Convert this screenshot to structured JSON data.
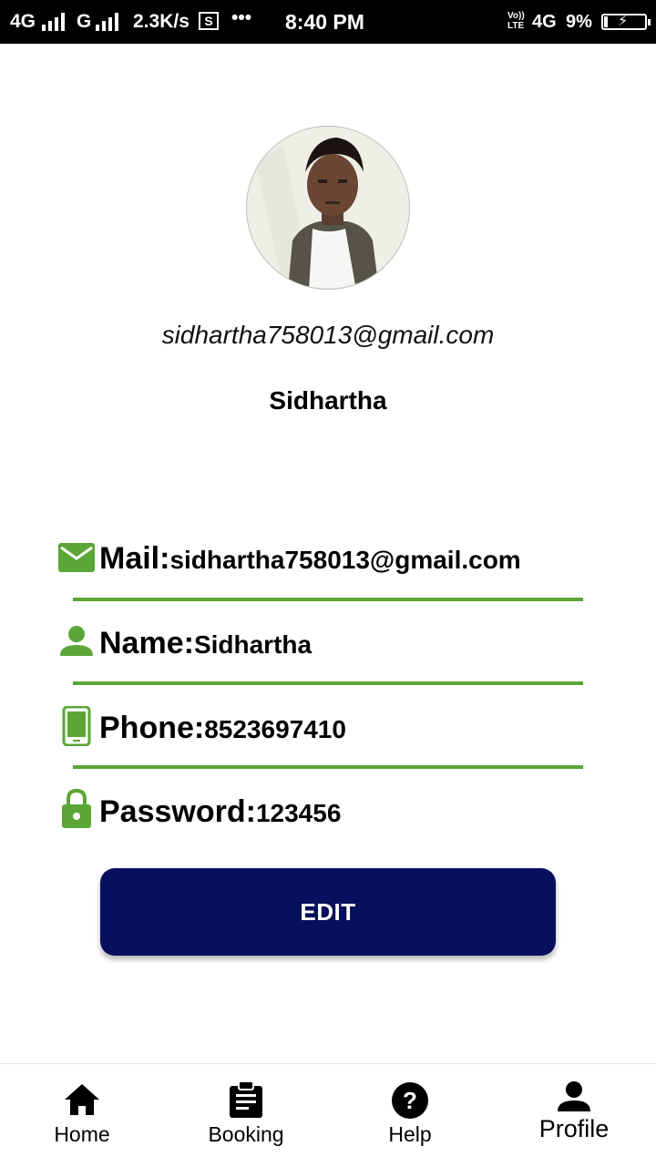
{
  "status_bar": {
    "network1": "4G",
    "network2": "G",
    "speed": "2.3K/s",
    "time": "8:40 PM",
    "volte": "Vo)) LTE",
    "network3": "4G",
    "battery": "9%",
    "battery_level": 0.09
  },
  "profile": {
    "email": "sidhartha758013@gmail.com",
    "name": "Sidhartha"
  },
  "fields": {
    "mail": {
      "label": "Mail:",
      "value": "sidhartha758013@gmail.com",
      "icon": "mail-icon"
    },
    "name": {
      "label": "Name:",
      "value": "Sidhartha",
      "icon": "person-icon"
    },
    "phone": {
      "label": "Phone:",
      "value": "8523697410",
      "icon": "phone-icon"
    },
    "password": {
      "label": "Password:",
      "value": "123456",
      "icon": "lock-icon"
    }
  },
  "edit_button": {
    "label": "EDIT"
  },
  "nav": {
    "home": "Home",
    "booking": "Booking",
    "help": "Help",
    "profile": "Profile"
  },
  "colors": {
    "accent_green": "#5ba636",
    "button_navy": "#06105c"
  }
}
